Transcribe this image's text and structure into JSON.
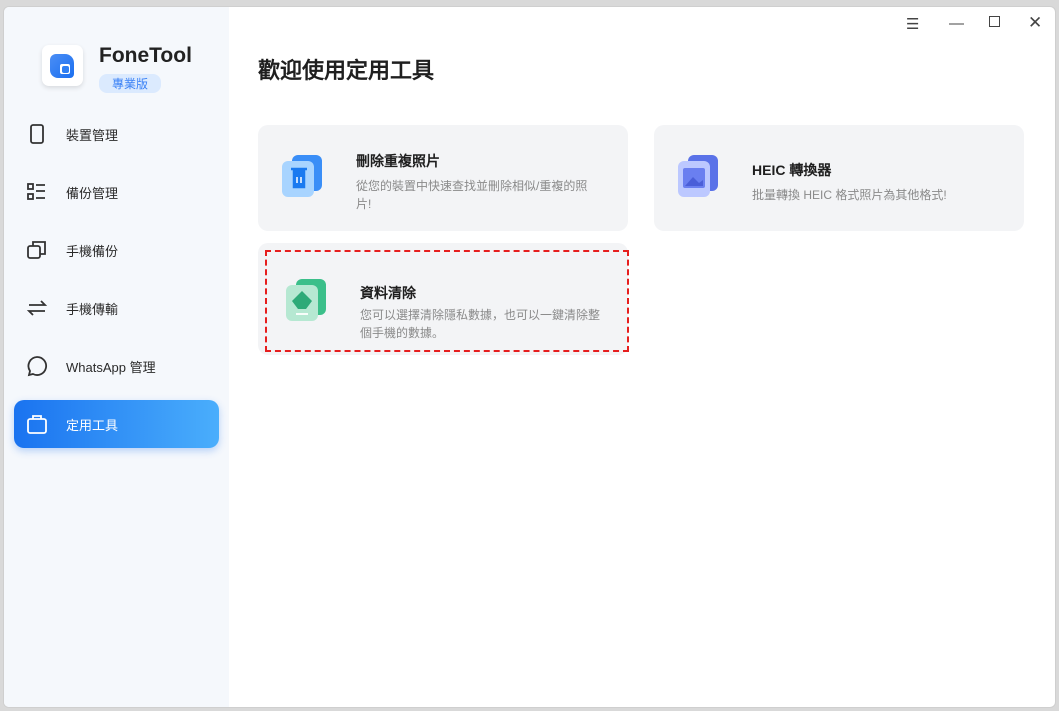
{
  "app": {
    "name": "FoneTool",
    "edition": "專業版"
  },
  "sidebar": {
    "items": [
      {
        "label": "裝置管理",
        "icon": "phone-icon"
      },
      {
        "label": "備份管理",
        "icon": "list-icon"
      },
      {
        "label": "手機備份",
        "icon": "copy-icon"
      },
      {
        "label": "手機傳輸",
        "icon": "transfer-icon"
      },
      {
        "label": "WhatsApp 管理",
        "icon": "chat-icon"
      },
      {
        "label": "定用工具",
        "icon": "toolbox-icon",
        "active": true
      }
    ]
  },
  "main": {
    "title": "歡迎使用定用工具",
    "cards": [
      {
        "title": "刪除重複照片",
        "desc": "從您的裝置中快速查找並刪除相似/重複的照片!",
        "icon": "trash-icon"
      },
      {
        "title": "HEIC 轉換器",
        "desc": "批量轉換 HEIC 格式照片為其他格式!",
        "icon": "image-icon"
      },
      {
        "title": "資料清除",
        "desc": "您可以選擇清除隱私數據，也可以一鍵清除整個手機的數據。",
        "icon": "eraser-icon"
      }
    ]
  },
  "colors": {
    "accent": "#1a73f0",
    "highlight": "#e61e1e"
  }
}
